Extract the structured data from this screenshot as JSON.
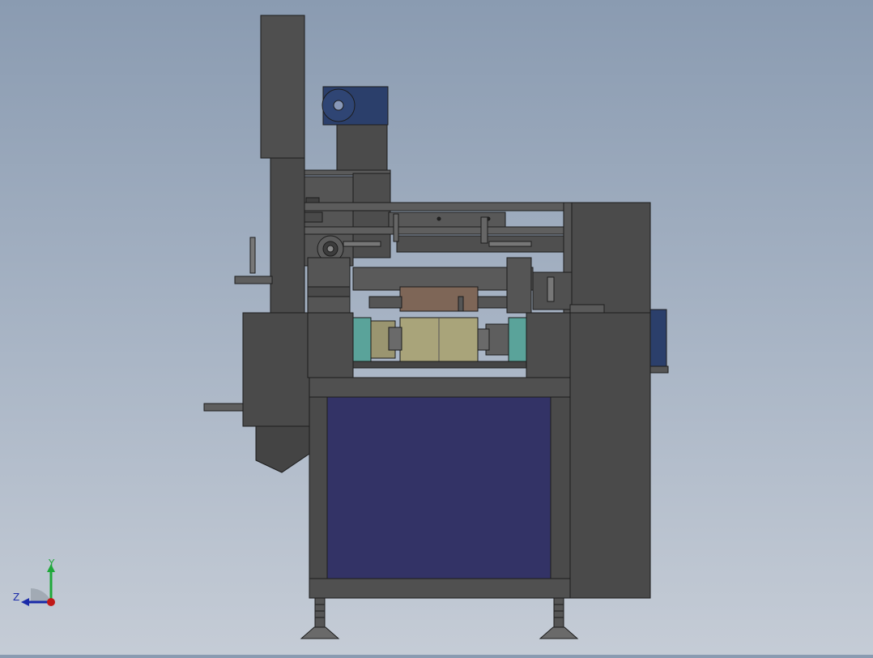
{
  "colors": {
    "machine_dark": "#4a4a4a",
    "machine_mid": "#555555",
    "machine_light": "#6a6a6a",
    "outline": "#1c1c1c",
    "panel_blue": "#333366",
    "motor_blue": "#2b3f6b",
    "roller_olive": "#a9a47a",
    "roller_brown": "#7e6657",
    "teal": "#5aa39a",
    "axis_x": "#c01818",
    "axis_y": "#1fa83a",
    "axis_z": "#1a2aa8"
  },
  "view": {
    "triad": {
      "y_label": "Y",
      "z_label": "Z"
    }
  }
}
